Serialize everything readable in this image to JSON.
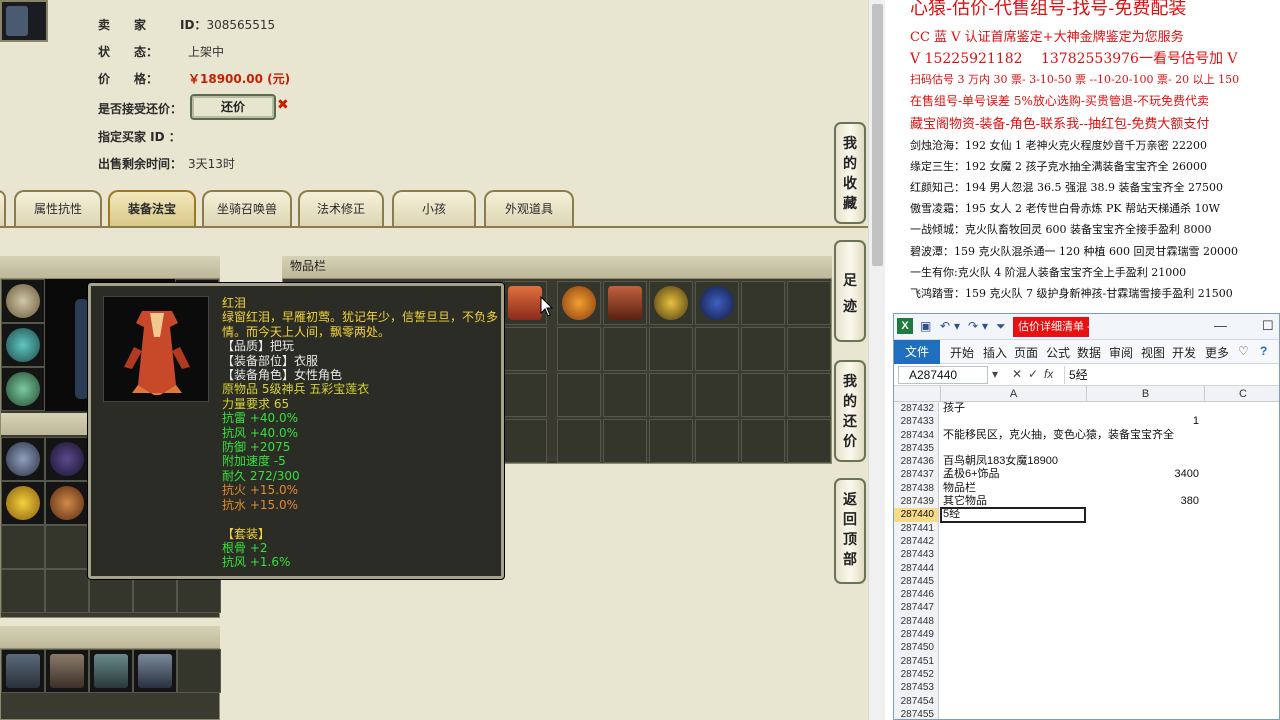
{
  "seller_info": {
    "seller_label": "卖　　家",
    "seller_id_label": "ID：",
    "seller_id": "308565515",
    "status_label": "状　　态：",
    "status": "上架中",
    "price_label": "价　　格：",
    "price": "￥18900.00 (元)",
    "accept_bargain_label": "是否接受还价：",
    "bargain_button": "还价",
    "designated_buyer_label": "指定买家 ID ：",
    "remaining_time_label": "出售剩余时间：",
    "remaining_time": "3天13时"
  },
  "tabs": [
    {
      "label": "属性抗性"
    },
    {
      "label": "装备法宝"
    },
    {
      "label": "坐骑召唤兽"
    },
    {
      "label": "法术修正"
    },
    {
      "label": "小孩"
    },
    {
      "label": "外观道具"
    }
  ],
  "inventory": {
    "title": "物品栏"
  },
  "side_buttons": [
    {
      "chars": [
        "我",
        "的",
        "收",
        "藏"
      ]
    },
    {
      "chars": [
        "足",
        "迹"
      ]
    },
    {
      "chars": [
        "我",
        "的",
        "还",
        "价"
      ]
    },
    {
      "chars": [
        "返",
        "回",
        "顶",
        "部"
      ]
    }
  ],
  "tooltip": {
    "name": "红泪",
    "lines": [
      {
        "text": "绿窗红泪，早雁初莺。犹记年少，信誓旦旦，不负多情。而今天上人间，飘零两处。",
        "color": "yellow"
      },
      {
        "text": "【品质】把玩",
        "color": "white"
      },
      {
        "text": "【装备部位】衣服",
        "color": "white"
      },
      {
        "text": "【装备角色】女性角色",
        "color": "white"
      },
      {
        "text": "原物品 5级神兵 五彩宝莲衣",
        "color": "olive"
      },
      {
        "text": "力量要求 65",
        "color": "olive"
      },
      {
        "text": "抗雷 +40.0%",
        "color": "green"
      },
      {
        "text": "抗风 +40.0%",
        "color": "green"
      },
      {
        "text": "防御 +2075",
        "color": "green"
      },
      {
        "text": "附加速度 -5",
        "color": "green"
      },
      {
        "text": "耐久 272/300",
        "color": "green"
      },
      {
        "text": "抗火 +15.0%",
        "color": "orange"
      },
      {
        "text": "抗水 +15.0%",
        "color": "orange"
      },
      {
        "text": " ",
        "color": "white"
      },
      {
        "text": "【套装】",
        "color": "yellow"
      },
      {
        "text": "根骨 +2",
        "color": "green"
      },
      {
        "text": "抗风 +1.6%",
        "color": "green"
      }
    ]
  },
  "ad": {
    "headline": "心猿-估价-代售组号-找号-免费配装",
    "line1": "CC 蓝 V 认证首席鉴定+大神金牌鉴定为您服务",
    "line2": "V 15225921182　 13782553976一看号估号加 V",
    "line3": "扫码估号 3 万内 30 票- 3-10-50 票 --10-20-100 票- 20 以上 150",
    "line4": "在售组号-单号误差 5%放心选购-买贵管退-不玩免费代卖",
    "line5": "藏宝阁物资-装备-角色-联系我--抽红包-免费大额支付",
    "listings": [
      "剑烛沧海：192 女仙 1 老神火克火程度妙音千万亲密 22200",
      "缘定三生：192 女魔 2 孩子克水抽全满装备宝宝齐全 26000",
      "红颜知己：194 男人忽混 36.5 强混 38.9 装备宝宝齐全 27500",
      "傲雪凌霜：195 女人 2 老传世白骨赤炼 PK 帮站天梯通杀 10W",
      "一战倾城：克火队畜牧回灵 600 装备宝宝齐全接手盈利 8000",
      "碧波潭：159 克火队混杀通一 120 种植 600 回灵甘霖瑞雪 20000",
      "一生有你:克火队 4 阶混人装备宝宝齐全上手盈利 21000",
      "飞鸿踏雪：159 克火队 7 级护身新神孩-甘霖瑞雪接手盈利 21500"
    ]
  },
  "excel": {
    "caption": "估价详细清单 - Microsoft Excel(...",
    "file_tab": "文件",
    "tabs": [
      "开始",
      "插入",
      "页面",
      "公式",
      "数据",
      "审阅",
      "视图",
      "开发",
      "更多"
    ],
    "name_box": "A287440",
    "formula_value": "5经",
    "col_a": "A",
    "col_b": "B",
    "col_c": "C",
    "rows": [
      {
        "n": "287432",
        "a": "孩子",
        "b": ""
      },
      {
        "n": "287433",
        "a": "",
        "b": "1"
      },
      {
        "n": "287434",
        "a": "不能移民区，克火抽，变色心猿，装备宝宝齐全",
        "b": ""
      },
      {
        "n": "287435",
        "a": "",
        "b": ""
      },
      {
        "n": "287436",
        "a": "百鸟朝凤183女魔18900",
        "b": ""
      },
      {
        "n": "287437",
        "a": "孟极6+饰品",
        "b": "3400"
      },
      {
        "n": "287438",
        "a": "物品栏",
        "b": ""
      },
      {
        "n": "287439",
        "a": "其它物品",
        "b": "380"
      },
      {
        "n": "287440",
        "a": "5经",
        "b": ""
      },
      {
        "n": "287441",
        "a": "",
        "b": ""
      },
      {
        "n": "287442",
        "a": "",
        "b": ""
      },
      {
        "n": "287443",
        "a": "",
        "b": ""
      },
      {
        "n": "287444",
        "a": "",
        "b": ""
      },
      {
        "n": "287445",
        "a": "",
        "b": ""
      },
      {
        "n": "287446",
        "a": "",
        "b": ""
      },
      {
        "n": "287447",
        "a": "",
        "b": ""
      },
      {
        "n": "287448",
        "a": "",
        "b": ""
      },
      {
        "n": "287449",
        "a": "",
        "b": ""
      },
      {
        "n": "287450",
        "a": "",
        "b": ""
      },
      {
        "n": "287451",
        "a": "",
        "b": ""
      },
      {
        "n": "287452",
        "a": "",
        "b": ""
      },
      {
        "n": "287453",
        "a": "",
        "b": ""
      },
      {
        "n": "287454",
        "a": "",
        "b": ""
      },
      {
        "n": "287455",
        "a": "",
        "b": ""
      }
    ],
    "active_row": "287440"
  },
  "colors": {
    "price_red": "#c81e00",
    "ad_red": "#e01010",
    "excel_caption_red": "#e81010",
    "excel_file_blue": "#1f6fbe",
    "tooltip_bg": "#2b2c25"
  }
}
